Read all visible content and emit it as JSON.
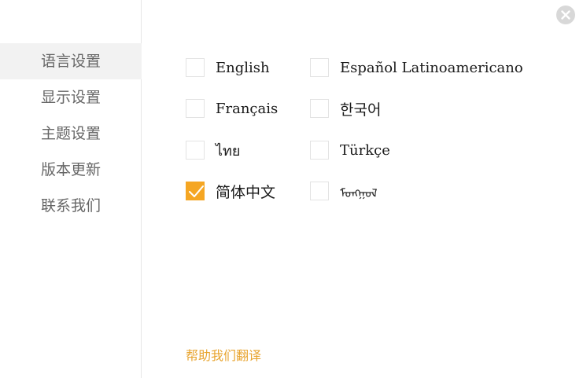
{
  "sidebar": {
    "items": [
      {
        "label": "语言设置",
        "active": true
      },
      {
        "label": "显示设置",
        "active": false
      },
      {
        "label": "主题设置",
        "active": false
      },
      {
        "label": "版本更新",
        "active": false
      },
      {
        "label": "联系我们",
        "active": false
      }
    ]
  },
  "close_icon": "close-circle-icon",
  "languages": [
    {
      "label": "English",
      "checked": false
    },
    {
      "label": "Español Latinoamericano",
      "checked": false
    },
    {
      "label": "Français",
      "checked": false
    },
    {
      "label": "한국어",
      "checked": false
    },
    {
      "label": "ไทย",
      "checked": false
    },
    {
      "label": "Türkçe",
      "checked": false
    },
    {
      "label": "简体中文",
      "checked": true
    },
    {
      "label": "ᠮᠣᠩᠭᠣᠯ",
      "checked": false
    }
  ],
  "help_link": "帮助我们翻译",
  "colors": {
    "accent": "#f5a623",
    "help_link": "#e8a531",
    "sidebar_active_bg": "#f2f2f2",
    "sidebar_text": "#666666"
  }
}
